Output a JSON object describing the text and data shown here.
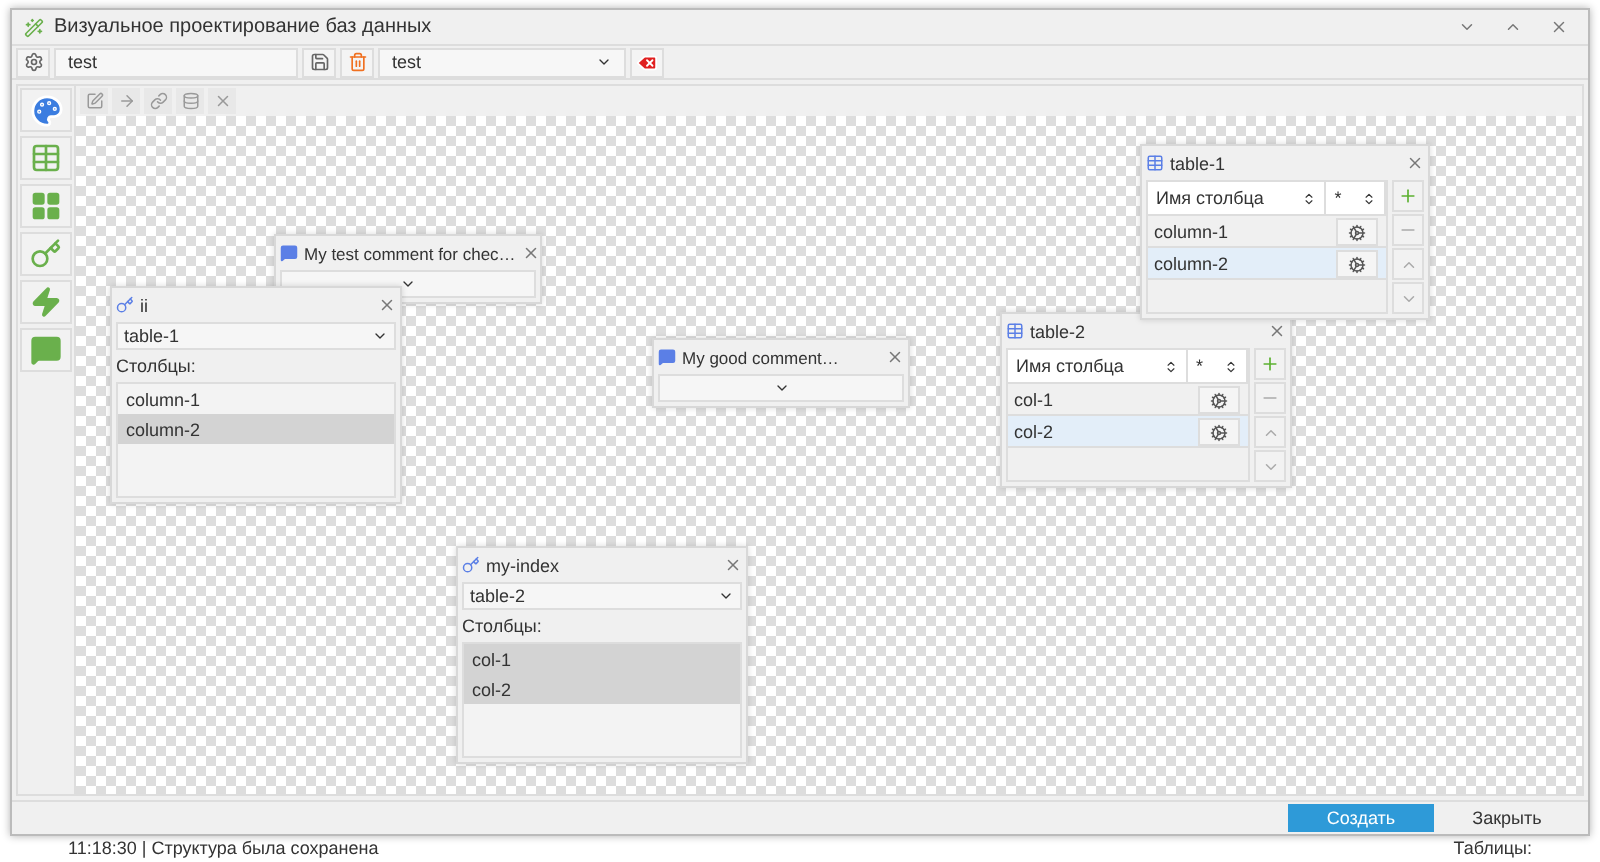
{
  "background": {
    "status_text": "11:18:30 | Структура была сохранена",
    "status_right": "Таблицы:"
  },
  "window": {
    "title": "Визуальное проектирование баз данных"
  },
  "toolbar": {
    "name_value": "test",
    "schema_value": "test"
  },
  "nodes": [
    {
      "kind": "comment",
      "title": "My test comment for chec…"
    },
    {
      "kind": "index",
      "title": "ii",
      "table": "table-1",
      "columns_label": "Столбцы:",
      "columns": [
        {
          "name": "column-1",
          "selected": false
        },
        {
          "name": "column-2",
          "selected": true
        }
      ]
    },
    {
      "kind": "comment",
      "title": "My good comment…"
    },
    {
      "kind": "table",
      "title": "table-2",
      "header": [
        "Имя столбца",
        "*"
      ],
      "rows": [
        {
          "name": "col-1",
          "selected": false
        },
        {
          "name": "col-2",
          "selected": true
        }
      ]
    },
    {
      "kind": "table",
      "title": "table-1",
      "header": [
        "Имя столбца",
        "*"
      ],
      "rows": [
        {
          "name": "column-1",
          "selected": false
        },
        {
          "name": "column-2",
          "selected": true
        }
      ]
    },
    {
      "kind": "index",
      "title": "my-index",
      "table": "table-2",
      "columns_label": "Столбцы:",
      "columns": [
        {
          "name": "col-1",
          "selected": true
        },
        {
          "name": "col-2",
          "selected": true
        }
      ]
    }
  ],
  "footer_buttons": [
    {
      "label": "Создать",
      "primary": true
    },
    {
      "label": "Закрыть",
      "primary": false
    }
  ]
}
